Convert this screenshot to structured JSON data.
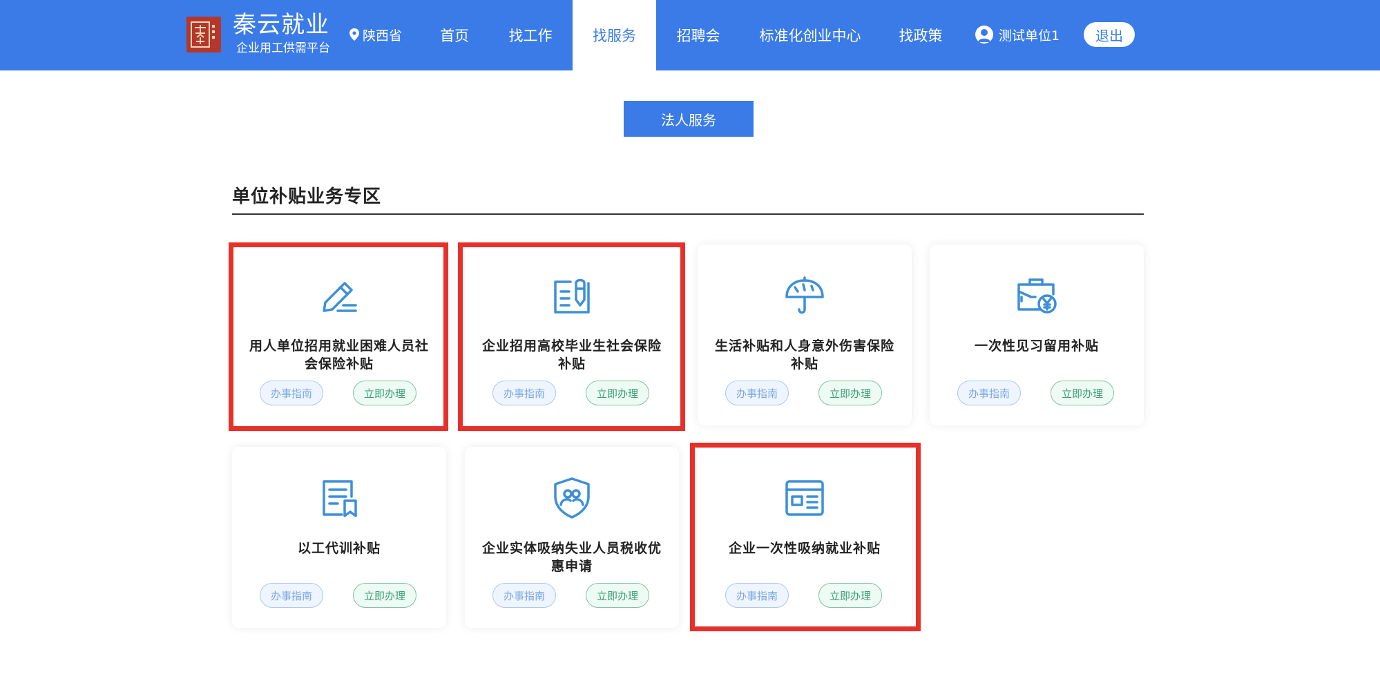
{
  "header": {
    "brand_title": "秦云就业",
    "brand_sub": "企业用工供需平台",
    "region": "陕西省",
    "nav": [
      "首页",
      "找工作",
      "找服务",
      "招聘会",
      "标准化创业中心",
      "找政策"
    ],
    "active_nav": "找服务",
    "user": "测试单位1",
    "logout": "退出"
  },
  "main": {
    "legal_button": "法人服务",
    "section_title": "单位补贴业务专区",
    "cards": [
      {
        "name": "用人单位招用就业困难人员社会保险补贴",
        "icon": "pen-icon",
        "guide": "办事指南",
        "handle": "立即办理",
        "highlighted": true
      },
      {
        "name": "企业招用高校毕业生社会保险补贴",
        "icon": "document-pen-icon",
        "guide": "办事指南",
        "handle": "立即办理",
        "highlighted": true
      },
      {
        "name": "生活补贴和人身意外伤害保险补贴",
        "icon": "umbrella-icon",
        "guide": "办事指南",
        "handle": "立即办理",
        "highlighted": false
      },
      {
        "name": "一次性见习留用补贴",
        "icon": "briefcase-yen-icon",
        "guide": "办事指南",
        "handle": "立即办理",
        "highlighted": false
      },
      {
        "name": "以工代训补贴",
        "icon": "document-bookmark-icon",
        "guide": "办事指南",
        "handle": "立即办理",
        "highlighted": false
      },
      {
        "name": "企业实体吸纳失业人员税收优惠申请",
        "icon": "shield-people-icon",
        "guide": "办事指南",
        "handle": "立即办理",
        "highlighted": false
      },
      {
        "name": "企业一次性吸纳就业补贴",
        "icon": "id-card-icon",
        "guide": "办事指南",
        "handle": "立即办理",
        "highlighted": true
      }
    ]
  },
  "colors": {
    "primary": "#3a7be8",
    "icon": "#3d8fd9",
    "highlight": "#e8302a",
    "logo": "#b5372b"
  }
}
